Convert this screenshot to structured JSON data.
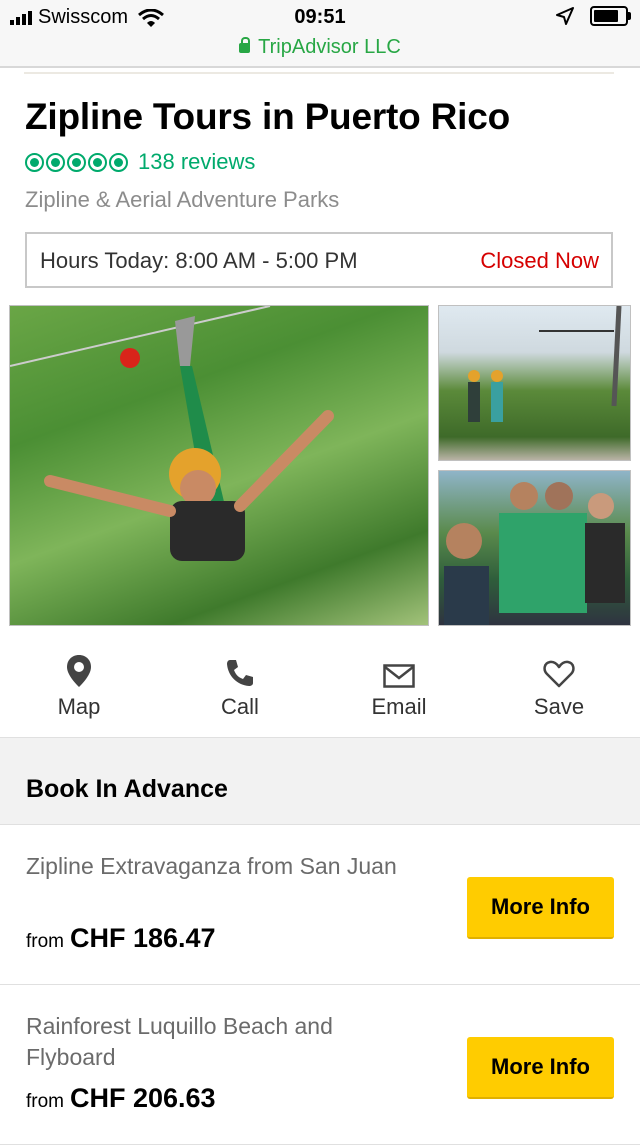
{
  "status_bar": {
    "carrier": "Swisscom",
    "time": "09:51"
  },
  "url_bar": {
    "site": "TripAdvisor LLC"
  },
  "listing": {
    "title": "Zipline Tours in Puerto Rico",
    "rating_bubbles": 5,
    "reviews": "138 reviews",
    "category": "Zipline & Aerial Adventure Parks",
    "hours_label": "Hours Today: 8:00 AM - 5:00 PM",
    "hours_status": "Closed Now"
  },
  "photos": [
    {
      "name": "zipline-rider-photo"
    },
    {
      "name": "zipline-platform-photo"
    },
    {
      "name": "group-selfie-photo"
    }
  ],
  "actions": [
    {
      "label": "Map",
      "icon": "map-pin-icon"
    },
    {
      "label": "Call",
      "icon": "phone-icon"
    },
    {
      "label": "Email",
      "icon": "envelope-icon"
    },
    {
      "label": "Save",
      "icon": "heart-icon"
    }
  ],
  "book": {
    "heading": "Book In Advance",
    "items": [
      {
        "name": "Zipline Extravaganza from San Juan",
        "from": "from",
        "price": "CHF 186.47",
        "button": "More Info"
      },
      {
        "name": "Rainforest Luquillo Beach and Flyboard",
        "from": "from",
        "price": "CHF 206.63",
        "button": "More Info"
      }
    ]
  },
  "colors": {
    "accent": "#00aa6c",
    "closed": "#d50000",
    "button": "#ffcc00",
    "url": "#28a745"
  }
}
